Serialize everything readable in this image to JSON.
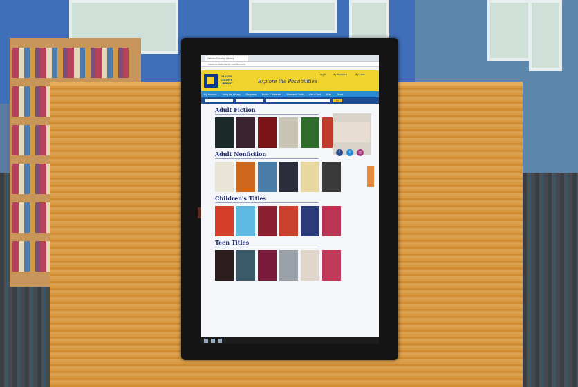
{
  "browser": {
    "tab_title": "Dakota County Library",
    "address": "www.co.dakota.mn.us/libraries"
  },
  "site": {
    "library_name": "DAKOTA COUNTY LIBRARY",
    "tagline": "Explore the Possibilities",
    "account_links": [
      "Log In",
      "My Account",
      "My Lists"
    ],
    "nav_items": [
      "My Account",
      "Using the Library",
      "Programs",
      "Books & Materials",
      "Research Tools",
      "Get a Card",
      "Kids",
      "About"
    ],
    "search_button": "Go"
  },
  "sections": [
    {
      "title": "Adult Fiction",
      "book_colors": [
        "#1d2a2a",
        "#3b2330",
        "#7a1418",
        "#c9c3b4",
        "#2f6b2a",
        "#c23a2b"
      ]
    },
    {
      "title": "Adult Nonfiction",
      "book_colors": [
        "#e9e4d6",
        "#d0681e",
        "#4a7ca8",
        "#2b2e3a",
        "#e8d8a0",
        "#3a3a3a"
      ]
    },
    {
      "title": "Children's Titles",
      "book_colors": [
        "#d6402a",
        "#5fb9e0",
        "#8a1f30",
        "#c9402e",
        "#2b3b7a",
        "#bb3355"
      ]
    },
    {
      "title": "Teen Titles",
      "book_colors": [
        "#2b1d1d",
        "#3a5a6a",
        "#7a1a3a",
        "#9aa0a8",
        "#e0d6cc",
        "#c23a5a"
      ]
    }
  ],
  "social_icons": [
    {
      "name": "facebook-icon",
      "color": "#2b4b8c",
      "glyph": "f"
    },
    {
      "name": "twitter-icon",
      "color": "#2a8bd4",
      "glyph": "t"
    },
    {
      "name": "instagram-icon",
      "color": "#a2327a",
      "glyph": "◎"
    }
  ]
}
